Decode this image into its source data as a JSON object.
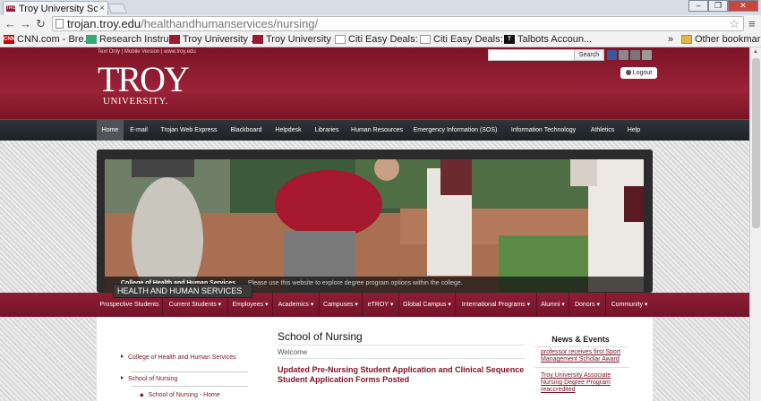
{
  "browser": {
    "tab_title": "Troy University Scho",
    "tab_favicon": "TROY",
    "url_domain": "trojan.troy.edu",
    "url_path": "/healthandhumanservices/nursing/",
    "window_buttons": [
      "–",
      "❐",
      "✕"
    ]
  },
  "bookmarks": [
    {
      "label": "CNN.com - Bre...",
      "icon": "cnn-icon",
      "color": "#c00"
    },
    {
      "label": "Research Instru...",
      "icon": "research-icon",
      "color": "#3a7"
    },
    {
      "label": "Troy University ...",
      "icon": "troy-icon",
      "color": "#9b1b30"
    },
    {
      "label": "Troy University ...",
      "icon": "troy-icon",
      "color": "#9b1b30"
    },
    {
      "label": "Citi Easy Deals: ...",
      "icon": "page-icon",
      "color": "#fff"
    },
    {
      "label": "Citi Easy Deals: ...",
      "icon": "page-icon",
      "color": "#fff"
    },
    {
      "label": "Talbots Accoun...",
      "icon": "talbots-icon",
      "color": "#111"
    }
  ],
  "bookmarks_overflow": "»",
  "other_bookmarks": "Other bookmarks",
  "header": {
    "util_links": "Text Only | Mobile Version | www.troy.edu",
    "logo_big": "TROY",
    "logo_small": "UNIVERSITY.",
    "search_button": "Search",
    "logout": "Logout"
  },
  "nav": [
    "Home",
    "E-mail",
    "Trojan Web Express",
    "Blackboard",
    "Helpdesk",
    "Libraries",
    "Human Resources",
    "Emergency Information (SOS)",
    "Information Technology",
    "Athletics",
    "Help"
  ],
  "slide": {
    "caption_title": "College of Health and Human Services",
    "caption_text": "Please use this website to explore degree program options within the college."
  },
  "subnav": [
    "Prospective Students",
    "Current Students ▾",
    "Employees ▾",
    "Academics ▾",
    "Campuses ▾",
    "eTROY ▾",
    "Global Campus ▾",
    "International Programs ▾",
    "Alumni ▾",
    "Donors ▾",
    "Community ▾"
  ],
  "sidebar": {
    "heading": "HEALTH AND HUMAN SERVICES",
    "items": [
      "College of Health and Human Services",
      "School of Nursing",
      "School of Nursing - Home"
    ]
  },
  "main": {
    "title": "School of Nursing",
    "welcome": "Welcome",
    "headline": "Updated Pre-Nursing Student Application and Clinical Sequence Student Application Forms Posted"
  },
  "news": {
    "heading": "News & Events",
    "items": [
      "professor receives first Sport Management Scholar Award",
      "Troy University Associate Nursing Degree Program reaccredited"
    ]
  }
}
